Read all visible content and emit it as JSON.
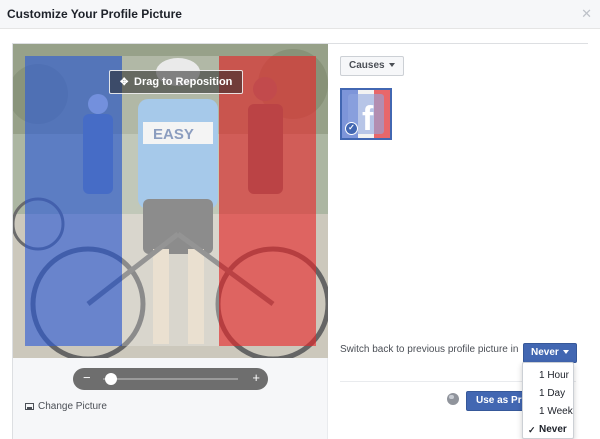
{
  "dialog": {
    "title": "Customize Your Profile Picture",
    "close_icon": "close-icon"
  },
  "editor": {
    "drag_label": "Drag to Reposition",
    "drag_icon": "move-arrows-icon",
    "zoom": {
      "minus": "−",
      "plus": "+",
      "level": 0.06
    },
    "change_picture_label": "Change Picture",
    "change_picture_icon": "picture-icon",
    "overlay_colors": {
      "blue": "#2b5bd7",
      "white": "#ffffff",
      "red": "#e8262a"
    }
  },
  "frames": {
    "category_label": "Causes",
    "selected_frame": "france-flag-facebook-frame",
    "check_icon": "checkmark-icon"
  },
  "switch_back": {
    "label": "Switch back to previous profile picture in",
    "selected": "Never",
    "options": [
      {
        "label": "1 Hour",
        "selected": false
      },
      {
        "label": "1 Day",
        "selected": false
      },
      {
        "label": "1 Week",
        "selected": false
      },
      {
        "label": "Never",
        "selected": true
      }
    ]
  },
  "footer": {
    "privacy_icon": "globe-icon",
    "use_button_label": "Use as Profile Picture"
  },
  "colors": {
    "accent": "#4267b2",
    "header_bg": "#f6f7f9",
    "border": "#dddfe2"
  }
}
